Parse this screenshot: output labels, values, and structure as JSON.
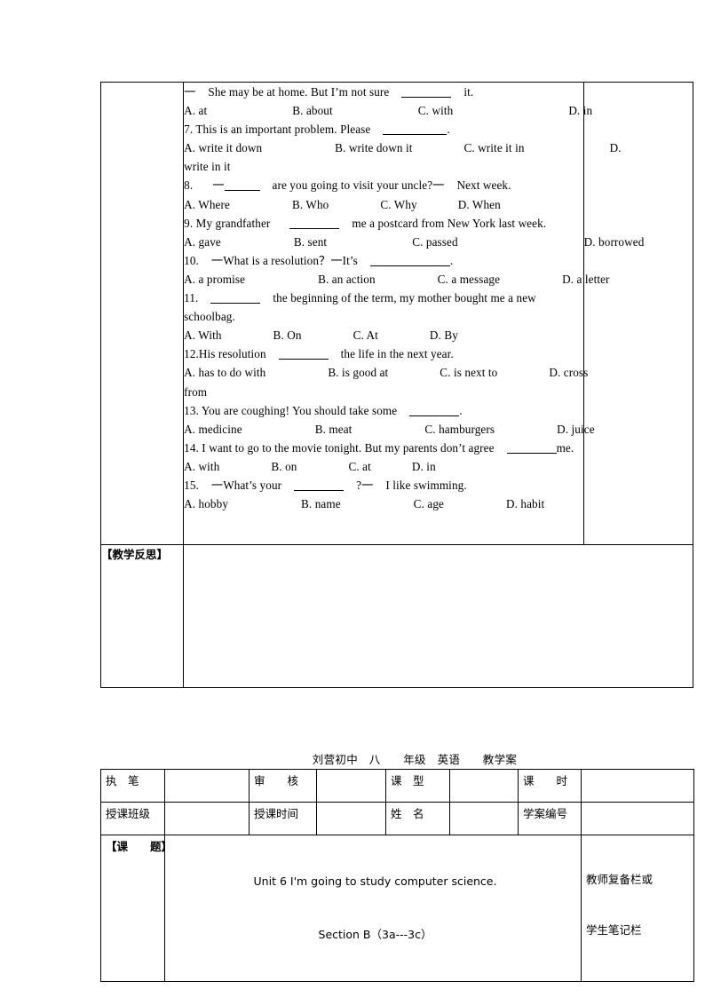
{
  "document": {
    "heading": "刘营初中　八　　年级　英语　　教学案"
  },
  "exercise_section": {
    "lines": [
      {
        "id": "q6-stem",
        "type": "stem",
        "text": "一  She may be at home. But I'm not sure ______ it."
      },
      {
        "id": "q6-opts",
        "type": "options",
        "text": "A. at            B. about            C. with                D. in"
      },
      {
        "id": "q7-stem",
        "type": "stem",
        "text": "7. This is an important problem. Please __________."
      },
      {
        "id": "q7-opts",
        "type": "options",
        "text": "A. write it down          B. write down it          C. write it in          D. write in it"
      },
      {
        "id": "q8-stem",
        "type": "stem",
        "text": "8.  一_____ are you going to visit your uncle?一  Next week."
      },
      {
        "id": "q8-opts",
        "type": "options",
        "text": "A. Where          B. Who          C. Why      D. When"
      },
      {
        "id": "q9-stem",
        "type": "stem",
        "text": "9. My grandfather _______ me a postcard from New York last week."
      },
      {
        "id": "q9-opts",
        "type": "options",
        "text": "A. gave          B. sent            C. passed              D. borrowed"
      },
      {
        "id": "q10-stem",
        "type": "stem",
        "text": "10. 一What is a resolution？一It's ____________."
      },
      {
        "id": "q10-opts",
        "type": "options",
        "text": "A. a promise          B. an action          C. a message        D. a letter"
      },
      {
        "id": "q11-stem",
        "type": "stem",
        "text": "11. ______ the beginning of the term, my mother bought me a new schoolbag."
      },
      {
        "id": "q11-opts",
        "type": "options",
        "text": "A. With        B. On        C. At        D. By"
      },
      {
        "id": "q12-stem",
        "type": "stem",
        "text": "12.His resolution _______ the life in the next year."
      },
      {
        "id": "q12-opts",
        "type": "options",
        "text": "A. has to do with          B. is good at          C. is next to       D. cross from"
      },
      {
        "id": "q13-stem",
        "type": "stem",
        "text": "13. You are coughing! You should take some _______."
      },
      {
        "id": "q13-opts",
        "type": "options",
        "text": "A. medicine            B. meat            C. hamburgers          D. juice"
      },
      {
        "id": "q14-stem",
        "type": "stem",
        "text": "14. I want to go to the movie tonight. But my parents don't agree _____me."
      },
      {
        "id": "q14-opts",
        "type": "options",
        "text": "A. with        B. on        C. at      D. in"
      },
      {
        "id": "q15-stem",
        "type": "stem",
        "text": "15. 一What's your _______ ?一 I like swimming."
      },
      {
        "id": "q15-opts",
        "type": "options",
        "text": "A. hobby            B. name            C. age          D. habit"
      }
    ]
  },
  "reflection_row": {
    "label": "【教学反思】",
    "content": ""
  },
  "info_table": {
    "rows": [
      [
        {
          "label": "执　笔",
          "value": ""
        },
        {
          "label": "审　　核",
          "value": ""
        },
        {
          "label": "课　型",
          "value": ""
        },
        {
          "label": "课　　时",
          "value": ""
        }
      ],
      [
        {
          "label": "授课班级",
          "value": ""
        },
        {
          "label": "授课时间",
          "value": ""
        },
        {
          "label": "姓　名",
          "value": ""
        },
        {
          "label": "学案编号",
          "value": ""
        }
      ]
    ],
    "subject_row": {
      "label": "【课　　题】",
      "title_line1": "Unit 6 I'm going to study computer science.",
      "title_line2": "Section B（3a---3c）",
      "note_column_line1": "教师复备栏或",
      "note_column_line2": "学生笔记栏"
    }
  }
}
